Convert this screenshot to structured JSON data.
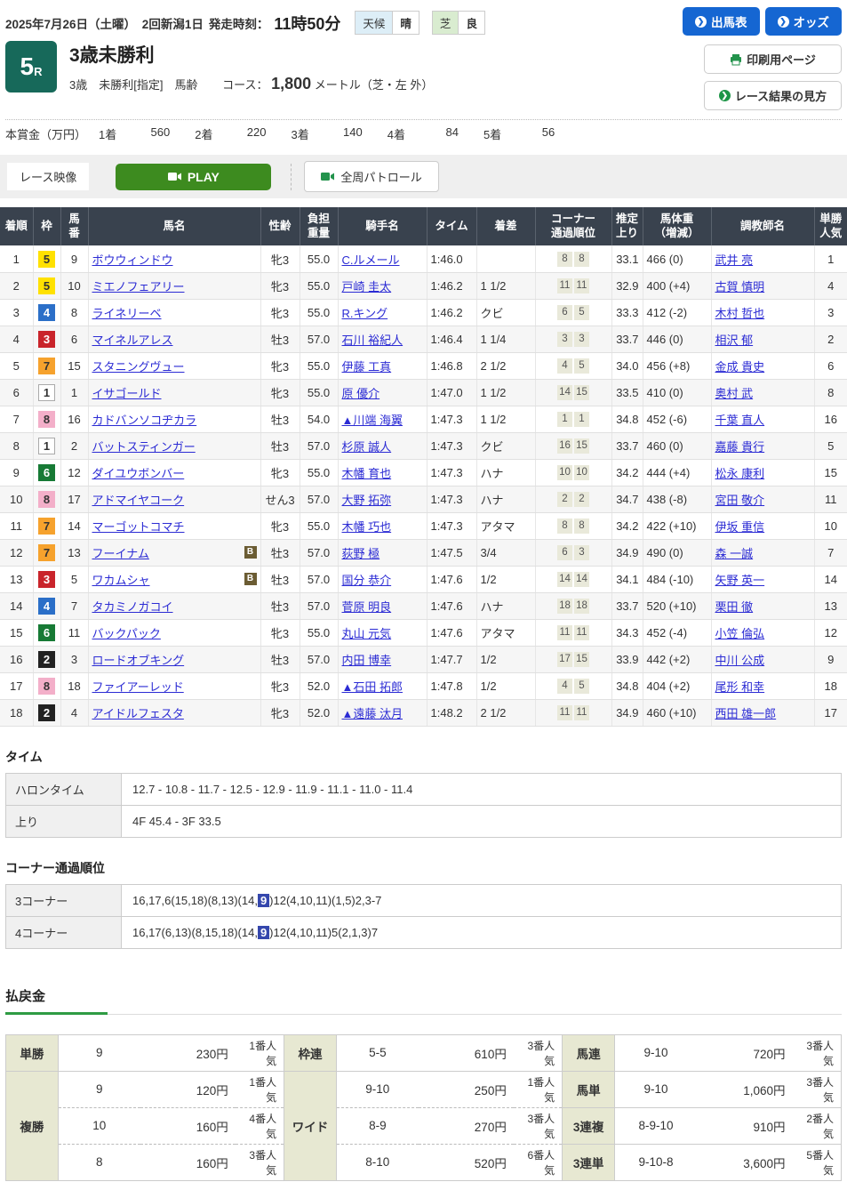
{
  "header": {
    "date_line": "2025年7月26日（土曜）　2回新潟1日",
    "start_label": "発走時刻：",
    "start_time": "11時50分",
    "weather_label": "天候",
    "weather_value": "晴",
    "turf_label": "芝",
    "turf_value": "良",
    "buttons": {
      "entries": "出馬表",
      "odds": "オッズ",
      "print": "印刷用ページ",
      "guide": "レース結果の見方"
    }
  },
  "race": {
    "number": "5",
    "number_suffix": "R",
    "title": "3歳未勝利",
    "conditions": "3歳　未勝利[指定]　馬齢",
    "course_label": "コース：",
    "course_distance": "1,800",
    "course_detail": "メートル（芝・左 外）",
    "prize_label": "本賞金（万円）",
    "prizes": [
      {
        "place": "1着",
        "amount": "560"
      },
      {
        "place": "2着",
        "amount": "220"
      },
      {
        "place": "3着",
        "amount": "140"
      },
      {
        "place": "4着",
        "amount": "84"
      },
      {
        "place": "5着",
        "amount": "56"
      }
    ]
  },
  "video": {
    "label": "レース映像",
    "play": "PLAY",
    "patrol": "全周パトロール"
  },
  "results": {
    "headers": [
      "着順",
      "枠",
      "馬\n番",
      "馬名",
      "性齢",
      "負担\n重量",
      "騎手名",
      "タイム",
      "着差",
      "コーナー\n通過順位",
      "推定\n上り",
      "馬体重\n（増減）",
      "調教師名",
      "単勝\n人気"
    ],
    "rows": [
      {
        "pos": "1",
        "frame": "5",
        "num": "9",
        "name": "ボウウィンドウ",
        "blinker": false,
        "sexage": "牝3",
        "weight": "55.0",
        "jockey": "C.ルメール",
        "time": "1:46.0",
        "margin": "",
        "c3": "8",
        "c4": "8",
        "last3f": "33.1",
        "hweight": "466 (0)",
        "trainer": "武井 亮",
        "pop": "1"
      },
      {
        "pos": "2",
        "frame": "5",
        "num": "10",
        "name": "ミエノフェアリー",
        "blinker": false,
        "sexage": "牝3",
        "weight": "55.0",
        "jockey": "戸崎 圭太",
        "time": "1:46.2",
        "margin": "1 1/2",
        "c3": "11",
        "c4": "11",
        "last3f": "32.9",
        "hweight": "400 (+4)",
        "trainer": "古賀 慎明",
        "pop": "4"
      },
      {
        "pos": "3",
        "frame": "4",
        "num": "8",
        "name": "ライネリーベ",
        "blinker": false,
        "sexage": "牝3",
        "weight": "55.0",
        "jockey": "R.キング",
        "time": "1:46.2",
        "margin": "クビ",
        "c3": "6",
        "c4": "5",
        "last3f": "33.3",
        "hweight": "412 (-2)",
        "trainer": "木村 哲也",
        "pop": "3"
      },
      {
        "pos": "4",
        "frame": "3",
        "num": "6",
        "name": "マイネルアレス",
        "blinker": false,
        "sexage": "牡3",
        "weight": "57.0",
        "jockey": "石川 裕紀人",
        "time": "1:46.4",
        "margin": "1 1/4",
        "c3": "3",
        "c4": "3",
        "last3f": "33.7",
        "hweight": "446 (0)",
        "trainer": "相沢 郁",
        "pop": "2"
      },
      {
        "pos": "5",
        "frame": "7",
        "num": "15",
        "name": "スタニングヴュー",
        "blinker": false,
        "sexage": "牝3",
        "weight": "55.0",
        "jockey": "伊藤 工真",
        "time": "1:46.8",
        "margin": "2 1/2",
        "c3": "4",
        "c4": "5",
        "last3f": "34.0",
        "hweight": "456 (+8)",
        "trainer": "金成 貴史",
        "pop": "6"
      },
      {
        "pos": "6",
        "frame": "1",
        "num": "1",
        "name": "イサゴールド",
        "blinker": false,
        "sexage": "牝3",
        "weight": "55.0",
        "jockey": "原 優介",
        "time": "1:47.0",
        "margin": "1 1/2",
        "c3": "14",
        "c4": "15",
        "last3f": "33.5",
        "hweight": "410 (0)",
        "trainer": "奥村 武",
        "pop": "8"
      },
      {
        "pos": "7",
        "frame": "8",
        "num": "16",
        "name": "カドバンソコヂカラ",
        "blinker": false,
        "sexage": "牡3",
        "weight": "54.0",
        "jockey": "▲川端 海翼",
        "time": "1:47.3",
        "margin": "1 1/2",
        "c3": "1",
        "c4": "1",
        "last3f": "34.8",
        "hweight": "452 (-6)",
        "trainer": "千葉 直人",
        "pop": "16"
      },
      {
        "pos": "8",
        "frame": "1",
        "num": "2",
        "name": "バットスティンガー",
        "blinker": false,
        "sexage": "牡3",
        "weight": "57.0",
        "jockey": "杉原 誠人",
        "time": "1:47.3",
        "margin": "クビ",
        "c3": "16",
        "c4": "15",
        "last3f": "33.7",
        "hweight": "460 (0)",
        "trainer": "嘉藤 貴行",
        "pop": "5"
      },
      {
        "pos": "9",
        "frame": "6",
        "num": "12",
        "name": "ダイユウボンバー",
        "blinker": false,
        "sexage": "牝3",
        "weight": "55.0",
        "jockey": "木幡 育也",
        "time": "1:47.3",
        "margin": "ハナ",
        "c3": "10",
        "c4": "10",
        "last3f": "34.2",
        "hweight": "444 (+4)",
        "trainer": "松永 康利",
        "pop": "15"
      },
      {
        "pos": "10",
        "frame": "8",
        "num": "17",
        "name": "アドマイヤコーク",
        "blinker": false,
        "sexage": "せん3",
        "weight": "57.0",
        "jockey": "大野 拓弥",
        "time": "1:47.3",
        "margin": "ハナ",
        "c3": "2",
        "c4": "2",
        "last3f": "34.7",
        "hweight": "438 (-8)",
        "trainer": "宮田 敬介",
        "pop": "11"
      },
      {
        "pos": "11",
        "frame": "7",
        "num": "14",
        "name": "マーゴットコマチ",
        "blinker": false,
        "sexage": "牝3",
        "weight": "55.0",
        "jockey": "木幡 巧也",
        "time": "1:47.3",
        "margin": "アタマ",
        "c3": "8",
        "c4": "8",
        "last3f": "34.2",
        "hweight": "422 (+10)",
        "trainer": "伊坂 重信",
        "pop": "10"
      },
      {
        "pos": "12",
        "frame": "7",
        "num": "13",
        "name": "フーイナム",
        "blinker": true,
        "sexage": "牡3",
        "weight": "57.0",
        "jockey": "荻野 極",
        "time": "1:47.5",
        "margin": "3/4",
        "c3": "6",
        "c4": "3",
        "last3f": "34.9",
        "hweight": "490 (0)",
        "trainer": "森 一誠",
        "pop": "7"
      },
      {
        "pos": "13",
        "frame": "3",
        "num": "5",
        "name": "ワカムシャ",
        "blinker": true,
        "sexage": "牡3",
        "weight": "57.0",
        "jockey": "国分 恭介",
        "time": "1:47.6",
        "margin": "1/2",
        "c3": "14",
        "c4": "14",
        "last3f": "34.1",
        "hweight": "484 (-10)",
        "trainer": "矢野 英一",
        "pop": "14"
      },
      {
        "pos": "14",
        "frame": "4",
        "num": "7",
        "name": "タカミノガコイ",
        "blinker": false,
        "sexage": "牡3",
        "weight": "57.0",
        "jockey": "菅原 明良",
        "time": "1:47.6",
        "margin": "ハナ",
        "c3": "18",
        "c4": "18",
        "last3f": "33.7",
        "hweight": "520 (+10)",
        "trainer": "栗田 徹",
        "pop": "13"
      },
      {
        "pos": "15",
        "frame": "6",
        "num": "11",
        "name": "バックパック",
        "blinker": false,
        "sexage": "牝3",
        "weight": "55.0",
        "jockey": "丸山 元気",
        "time": "1:47.6",
        "margin": "アタマ",
        "c3": "11",
        "c4": "11",
        "last3f": "34.3",
        "hweight": "452 (-4)",
        "trainer": "小笠 倫弘",
        "pop": "12"
      },
      {
        "pos": "16",
        "frame": "2",
        "num": "3",
        "name": "ロードオブキング",
        "blinker": false,
        "sexage": "牡3",
        "weight": "57.0",
        "jockey": "内田 博幸",
        "time": "1:47.7",
        "margin": "1/2",
        "c3": "17",
        "c4": "15",
        "last3f": "33.9",
        "hweight": "442 (+2)",
        "trainer": "中川 公成",
        "pop": "9"
      },
      {
        "pos": "17",
        "frame": "8",
        "num": "18",
        "name": "ファイアーレッド",
        "blinker": false,
        "sexage": "牝3",
        "weight": "52.0",
        "jockey": "▲石田 拓郎",
        "time": "1:47.8",
        "margin": "1/2",
        "c3": "4",
        "c4": "5",
        "last3f": "34.8",
        "hweight": "404 (+2)",
        "trainer": "尾形 和幸",
        "pop": "18"
      },
      {
        "pos": "18",
        "frame": "2",
        "num": "4",
        "name": "アイドルフェスタ",
        "blinker": false,
        "sexage": "牝3",
        "weight": "52.0",
        "jockey": "▲遠藤 汰月",
        "time": "1:48.2",
        "margin": "2 1/2",
        "c3": "11",
        "c4": "11",
        "last3f": "34.9",
        "hweight": "460 (+10)",
        "trainer": "西田 雄一郎",
        "pop": "17"
      }
    ]
  },
  "time_section": {
    "heading": "タイム",
    "furlong_label": "ハロンタイム",
    "furlong_value": "12.7 - 10.8 - 11.7 - 12.5 - 12.9 - 11.9 - 11.1 - 11.0 - 11.4",
    "agari_label": "上り",
    "agari_value": "4F 45.4 - 3F 33.5"
  },
  "corner_section": {
    "heading": "コーナー通過順位",
    "rows": [
      {
        "label": "3コーナー",
        "prefix": "16,17,6(15,18)(8,13)(14,",
        "highlight": "9",
        "suffix": ")12(4,10,11)(1,5)2,3-7"
      },
      {
        "label": "4コーナー",
        "prefix": "16,17(6,13)(8,15,18)(14,",
        "highlight": "9",
        "suffix": ")12(4,10,11)5(2,1,3)7"
      }
    ]
  },
  "payout": {
    "heading": "払戻金",
    "groups": [
      {
        "cells": [
          {
            "label": "単勝",
            "rows": [
              [
                "9",
                "230円",
                "1番人気"
              ]
            ]
          },
          {
            "label": "複勝",
            "rows": [
              [
                "9",
                "120円",
                "1番人気"
              ],
              [
                "10",
                "160円",
                "4番人気"
              ],
              [
                "8",
                "160円",
                "3番人気"
              ]
            ]
          }
        ]
      },
      {
        "cells": [
          {
            "label": "枠連",
            "rows": [
              [
                "5-5",
                "610円",
                "3番人気"
              ]
            ]
          },
          {
            "label": "ワイド",
            "rows": [
              [
                "9-10",
                "250円",
                "1番人気"
              ],
              [
                "8-9",
                "270円",
                "3番人気"
              ],
              [
                "8-10",
                "520円",
                "6番人気"
              ]
            ]
          }
        ]
      },
      {
        "cells": [
          {
            "label": "馬連",
            "rows": [
              [
                "9-10",
                "720円",
                "3番人気"
              ]
            ]
          },
          {
            "label": "馬単",
            "rows": [
              [
                "9-10",
                "1,060円",
                "3番人気"
              ]
            ]
          },
          {
            "label": "3連複",
            "rows": [
              [
                "8-9-10",
                "910円",
                "2番人気"
              ]
            ]
          },
          {
            "label": "3連単",
            "rows": [
              [
                "9-10-8",
                "3,600円",
                "5番人気"
              ]
            ]
          }
        ]
      }
    ]
  }
}
